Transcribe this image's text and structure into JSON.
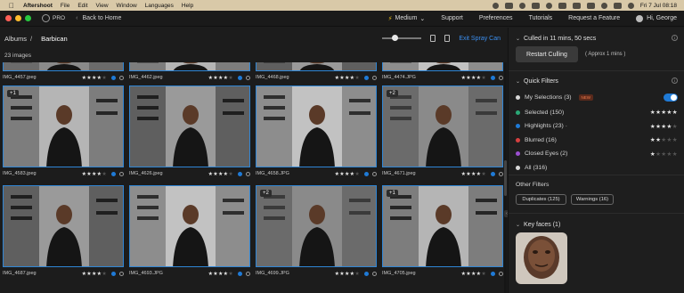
{
  "menubar": {
    "items": [
      "Aftershoot",
      "File",
      "Edit",
      "View",
      "Window",
      "Languages",
      "Help"
    ],
    "datetime": "Fri 7 Jul  08:18"
  },
  "appbar": {
    "logo_label": "PRO",
    "back_label": "Back to Home",
    "speed_label": "Medium",
    "nav": [
      "Support",
      "Preferences",
      "Tutorials",
      "Request a Feature"
    ],
    "user_label": "Hi, George",
    "traffic_lights": [
      "#ff5f57",
      "#febc2e",
      "#28c840"
    ]
  },
  "toolbar": {
    "breadcrumb_root": "Albums",
    "breadcrumb_sep": "/",
    "breadcrumb_current": "Barbican",
    "exit_label": "Exit Spray Can",
    "zoom_level": 0.25
  },
  "image_count": "23 images",
  "grid": {
    "rows": [
      {
        "cells": [
          {
            "name": "IMG_4457.jpeg",
            "rating": 4,
            "badge": "",
            "flag": true
          },
          {
            "name": "IMG_4462.jpeg",
            "rating": 4,
            "badge": "",
            "flag": true
          },
          {
            "name": "IMG_4468.jpeg",
            "rating": 4,
            "badge": "",
            "flag": true
          },
          {
            "name": "IMG_4474.JPG",
            "rating": 4,
            "badge": "",
            "flag": true
          }
        ]
      },
      {
        "cells": [
          {
            "name": "IMG_4583.jpeg",
            "rating": 4,
            "badge": "+1",
            "flag": true
          },
          {
            "name": "IMG_4626.jpeg",
            "rating": 4,
            "badge": "",
            "flag": true
          },
          {
            "name": "IMG_4658.JPG",
            "rating": 4,
            "badge": "",
            "flag": true
          },
          {
            "name": "IMG_4671.jpeg",
            "rating": 4,
            "badge": "+2",
            "flag": true
          }
        ]
      },
      {
        "cells": [
          {
            "name": "IMG_4687.jpeg",
            "rating": 4,
            "badge": "",
            "flag": true
          },
          {
            "name": "IMG_4693.JPG",
            "rating": 4,
            "badge": "",
            "flag": true
          },
          {
            "name": "IMG_4699.JPG",
            "rating": 4,
            "badge": "+2",
            "flag": true
          },
          {
            "name": "IMG_4705.jpeg",
            "rating": 4,
            "badge": "+1",
            "flag": true
          }
        ]
      }
    ]
  },
  "panel": {
    "culled_text": "Culled in 11 mins, 50 secs",
    "restart_label": "Restart Culling",
    "approx_text": "( Approx 1 mins )",
    "quick_filters_title": "Quick Filters",
    "my_selections": {
      "label": "My Selections (3)",
      "tag": "NEW",
      "enabled": true
    },
    "filters": [
      {
        "label": "Selected (150)",
        "color": "#2aa876",
        "rating": 5
      },
      {
        "label": "Highlights (23) ·",
        "color": "#1f7ad6",
        "rating": 4
      },
      {
        "label": "Blurred (16)",
        "color": "#d64040",
        "rating": 2
      },
      {
        "label": "Closed Eyes (2)",
        "color": "#9b4fd0",
        "rating": 1
      },
      {
        "label": "All (316)",
        "color": "#d8d8d8",
        "rating": 0
      }
    ],
    "other_filters_title": "Other Filters",
    "other_filters": [
      "Duplicates (125)",
      "Warnings (16)"
    ],
    "key_faces_title": "Key faces (1)"
  },
  "icons": {
    "back": "chevron-left-icon",
    "speed": "bolt-icon",
    "speed_dropdown": "chevron-down-icon",
    "info": "info-icon",
    "collapse": "chevron-down-icon"
  }
}
